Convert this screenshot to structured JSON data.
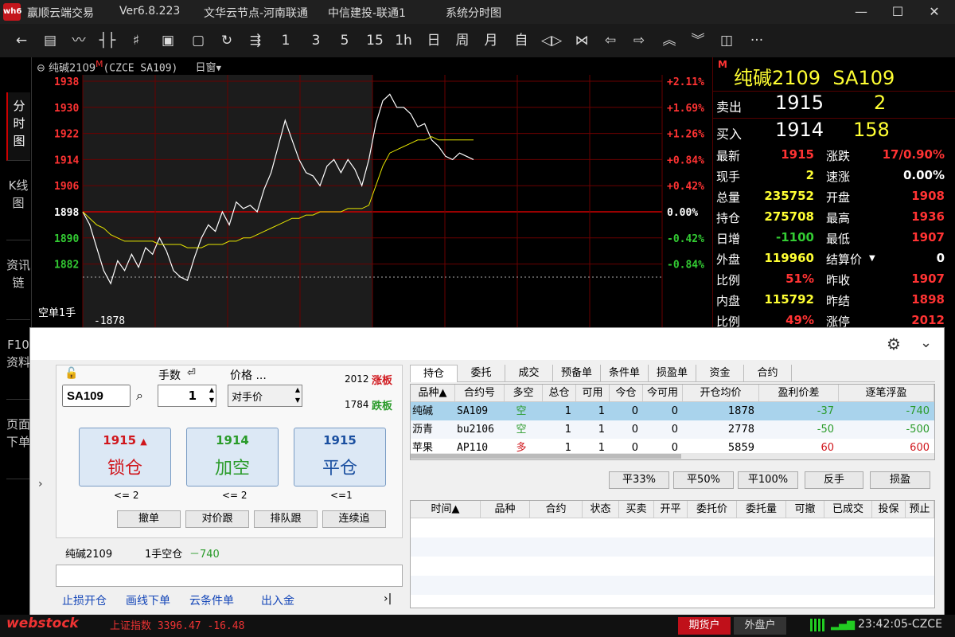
{
  "title": {
    "app": "赢顺云端交易",
    "version": "Ver6.8.223",
    "server": "文华云节点-河南联通",
    "broker": "中信建投-联通1",
    "page": "系统分时图"
  },
  "toolbar": {
    "icons": [
      "back-icon",
      "table-icon",
      "line-chart-icon",
      "candle-icon",
      "tick-icon",
      "account-icon",
      "save-icon",
      "refresh-icon",
      "draw-icon"
    ],
    "periods": [
      "1",
      "3",
      "5",
      "15",
      "1h",
      "日",
      "周",
      "月",
      "自"
    ]
  },
  "left_tabs": [
    "分时图",
    "K线图",
    "资讯链",
    "F10资料",
    "页面下单"
  ],
  "chart": {
    "symbol": "纯碱2109",
    "marker": "M",
    "exchange": "(CZCE SA109)",
    "window": "日窗",
    "y_left": [
      "1938",
      "1930",
      "1922",
      "1914",
      "1906",
      "1898",
      "1890",
      "1882"
    ],
    "y_right": [
      "+2.11%",
      "+1.69%",
      "+1.26%",
      "+0.84%",
      "+0.42%",
      "0.00%",
      "-0.42%",
      "-0.84%"
    ],
    "cursor_label": "空单1手",
    "cursor_value": "-1878",
    "cursor_extra": "-740元"
  },
  "chart_data": {
    "type": "line",
    "title": "纯碱2109",
    "ylim": [
      1878,
      1938
    ],
    "ref": 1898,
    "price": [
      1898,
      1894,
      1887,
      1880,
      1876,
      1883,
      1880,
      1885,
      1881,
      1887,
      1885,
      1890,
      1886,
      1880,
      1878,
      1877,
      1884,
      1890,
      1894,
      1892,
      1898,
      1894,
      1901,
      1899,
      1900,
      1898,
      1905,
      1910,
      1918,
      1926,
      1920,
      1914,
      1910,
      1909,
      1906,
      1912,
      1914,
      1910,
      1914,
      1911,
      1906,
      1914,
      1925,
      1932,
      1934,
      1930,
      1930,
      1928,
      1924,
      1925,
      1920,
      1918,
      1915,
      1914,
      1916,
      1915,
      1914
    ],
    "avg": [
      1898,
      1896,
      1894,
      1893,
      1891,
      1890,
      1889,
      1889,
      1889,
      1889,
      1889,
      1888,
      1888,
      1888,
      1888,
      1887,
      1887,
      1887,
      1888,
      1888,
      1888,
      1889,
      1889,
      1890,
      1890,
      1891,
      1892,
      1893,
      1894,
      1895,
      1896,
      1896,
      1897,
      1897,
      1898,
      1898,
      1898,
      1898,
      1899,
      1899,
      1899,
      1900,
      1906,
      1912,
      1916,
      1917,
      1918,
      1919,
      1920,
      1920,
      1921,
      1920,
      1920,
      1920,
      1920,
      1920,
      1920
    ]
  },
  "quote": {
    "symbol": "纯碱2109",
    "code": "SA109",
    "marker": "M",
    "sell": {
      "label": "卖出",
      "price": "1915",
      "vol": "2"
    },
    "buy": {
      "label": "买入",
      "price": "1914",
      "vol": "158"
    },
    "rows": [
      [
        "最新",
        "1915",
        "涨跌",
        "17/0.90%"
      ],
      [
        "现手",
        "2",
        "速涨",
        "0.00%"
      ],
      [
        "总量",
        "235752",
        "开盘",
        "1908"
      ],
      [
        "持仓",
        "275708",
        "最高",
        "1936"
      ],
      [
        "日增",
        "-1100",
        "最低",
        "1907"
      ],
      [
        "外盘",
        "119960",
        "结算价",
        "0"
      ],
      [
        "比例",
        "51%",
        "昨收",
        "1907"
      ],
      [
        "内盘",
        "115792",
        "昨结",
        "1898"
      ],
      [
        "比例",
        "49%",
        "涨停",
        "2012"
      ]
    ]
  },
  "order": {
    "contract": "SA109",
    "qty_label": "手数",
    "qty": "1",
    "price_label": "价格 ...",
    "price_type": "对手价",
    "limit_up": "2012",
    "limit_up_label": "涨板",
    "limit_down": "1784",
    "limit_down_label": "跌板",
    "buttons": [
      {
        "price": "1915",
        "label": "锁仓",
        "hint": "<= 2",
        "color": "#d0161c"
      },
      {
        "price": "1914",
        "label": "加空",
        "hint": "<= 2",
        "color": "#2a9b2a"
      },
      {
        "price": "1915",
        "label": "平仓",
        "hint": "<=1",
        "color": "#1a4fa0"
      }
    ],
    "actions": [
      "撤单",
      "对价跟",
      "排队跟",
      "连续追"
    ],
    "position_line": {
      "name": "纯碱2109",
      "desc": "1手空仓",
      "pnl": "－740"
    },
    "links": [
      "止损开仓",
      "画线下单",
      "云条件单",
      "出入金"
    ]
  },
  "tabs": [
    "持仓",
    "委托",
    "成交",
    "预备单",
    "条件单",
    "损盈单",
    "资金",
    "合约"
  ],
  "positions": {
    "headers": [
      "品种▲",
      "合约号",
      "多空",
      "总仓",
      "可用",
      "今仓",
      "今可用",
      "开仓均价",
      "盈利价差",
      "逐笔浮盈"
    ],
    "rows": [
      [
        "纯碱",
        "SA109",
        "空",
        "1",
        "1",
        "0",
        "0",
        "1878",
        "-37",
        "-740"
      ],
      [
        "沥青",
        "bu2106",
        "空",
        "1",
        "1",
        "0",
        "0",
        "2778",
        "-50",
        "-500"
      ],
      [
        "苹果",
        "AP110",
        "多",
        "1",
        "1",
        "0",
        "0",
        "5859",
        "60",
        "600"
      ]
    ]
  },
  "close_buttons": [
    "平33%",
    "平50%",
    "平100%",
    "反手",
    "损盈"
  ],
  "orders": {
    "headers": [
      "时间▲",
      "品种",
      "合约",
      "状态",
      "买卖",
      "开平",
      "委托价",
      "委托量",
      "可撤",
      "已成交",
      "投保",
      "预止"
    ]
  },
  "status": {
    "brand": "webstock",
    "index": "上证指数 3396.47 -16.48",
    "account_btn": "期货户",
    "account_btn2": "外盘户",
    "clock": "23:42:05-CZCE"
  }
}
